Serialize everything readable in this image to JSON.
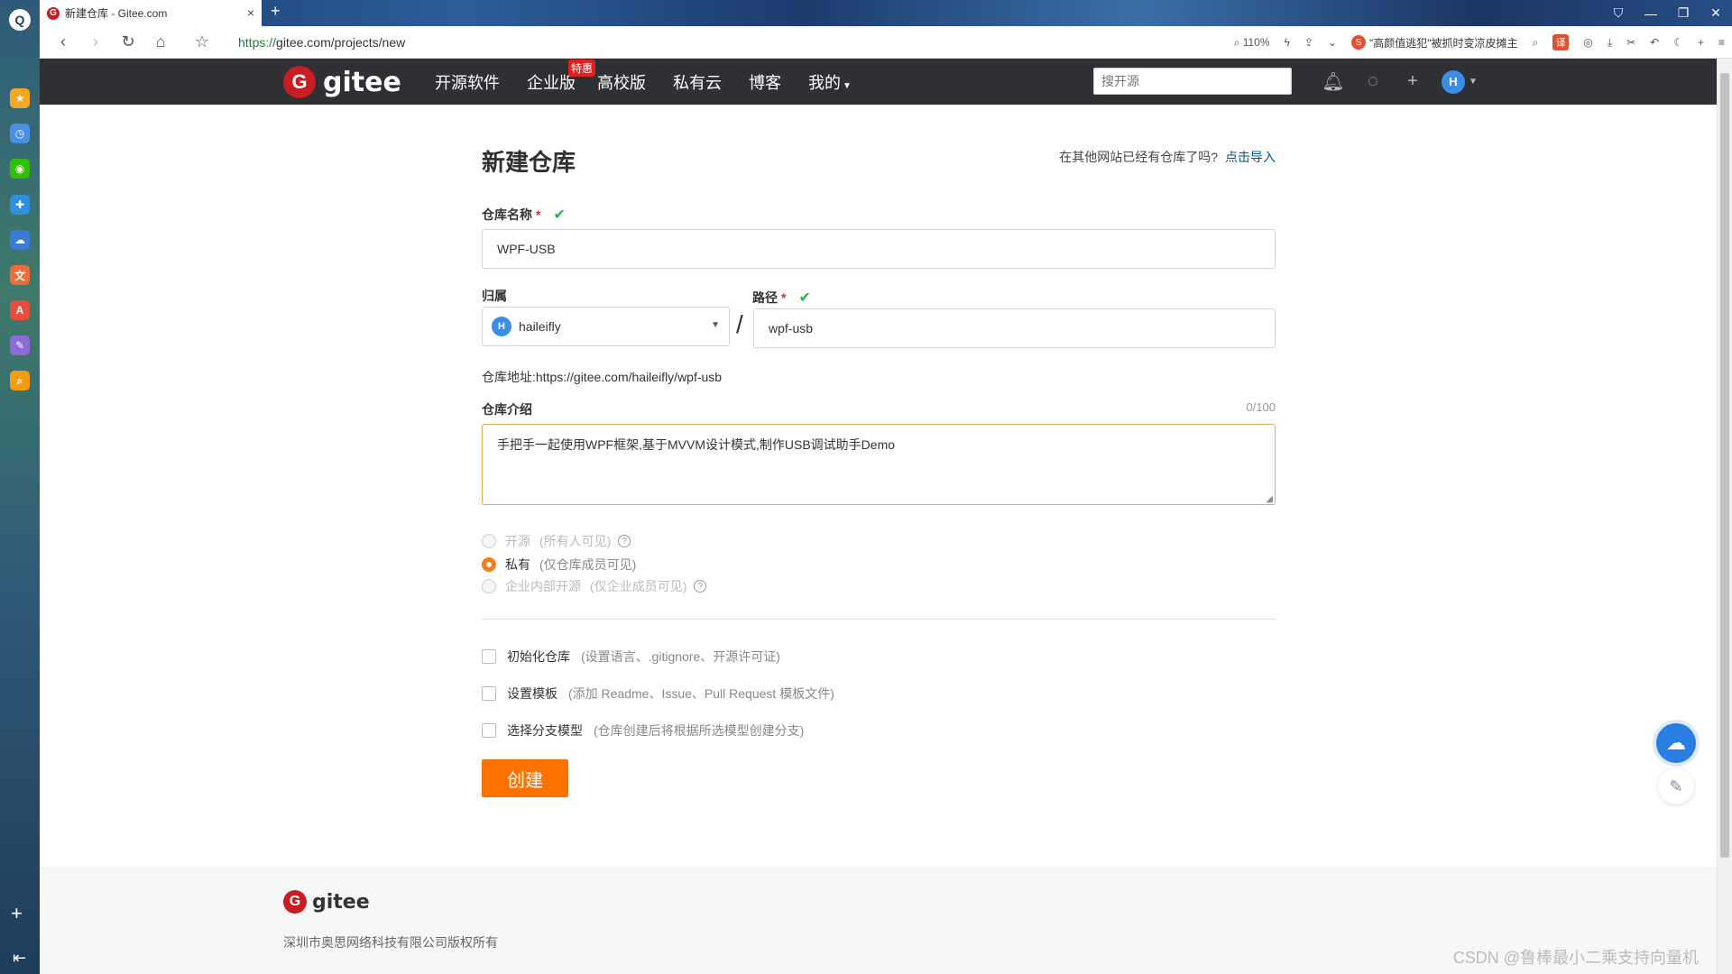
{
  "browser": {
    "tab_title": "新建仓库 - Gitee.com",
    "url_scheme": "https://",
    "url_rest": "gitee.com/projects/new",
    "zoom": "110%",
    "news_ticker": "\"高颜值逃犯\"被抓时变凉皮摊主",
    "translate_badge": "译"
  },
  "sidebar": {
    "icons": [
      {
        "name": "favorites-icon",
        "color": "#f5a623",
        "glyph": "★"
      },
      {
        "name": "history-icon",
        "color": "#4a90e2",
        "glyph": "◷"
      },
      {
        "name": "wechat-icon",
        "color": "#2dc100",
        "glyph": "◉"
      },
      {
        "name": "app-icon",
        "color": "#2f8fdd",
        "glyph": "✚"
      },
      {
        "name": "cloud-icon",
        "color": "#3a7bd5",
        "glyph": "☁"
      },
      {
        "name": "translate-icon",
        "color": "#ef6b3a",
        "glyph": "文"
      },
      {
        "name": "pdf-icon",
        "color": "#e84c3d",
        "glyph": "A"
      },
      {
        "name": "notes-icon",
        "color": "#8e6ad8",
        "glyph": "✎"
      },
      {
        "name": "search-app-icon",
        "color": "#f39c12",
        "glyph": "⌕"
      }
    ]
  },
  "header": {
    "logo_text": "gitee",
    "nav": [
      {
        "label": "开源软件"
      },
      {
        "label": "企业版",
        "badge": "特惠"
      },
      {
        "label": "高校版"
      },
      {
        "label": "私有云"
      },
      {
        "label": "博客"
      },
      {
        "label": "我的"
      }
    ],
    "search_placeholder": "搜开源",
    "avatar_letter": "H"
  },
  "form": {
    "title": "新建仓库",
    "import_tip": "在其他网站已经有仓库了吗?",
    "import_link": "点击导入",
    "repo_name_label": "仓库名称",
    "repo_name_value": "WPF-USB",
    "owner_label": "归属",
    "owner_avatar": "H",
    "owner_value": "haileifly",
    "path_label": "路径",
    "path_value": "wpf-usb",
    "repo_url_text": "仓库地址:https://gitee.com/haileifly/wpf-usb",
    "desc_label": "仓库介绍",
    "desc_count": "0/100",
    "desc_value": "手把手一起使用WPF框架,基于MVVM设计模式,制作USB调试助手Demo",
    "visibility": [
      {
        "label": "开源",
        "note": "(所有人可见)",
        "checked": false,
        "disabled": true,
        "help": true
      },
      {
        "label": "私有",
        "note": "(仅仓库成员可见)",
        "checked": true,
        "disabled": false,
        "help": false
      },
      {
        "label": "企业内部开源",
        "note": "(仅企业成员可见)",
        "checked": false,
        "disabled": true,
        "help": true
      }
    ],
    "options": [
      {
        "label": "初始化仓库",
        "note": "(设置语言、.gitignore、开源许可证)"
      },
      {
        "label": "设置模板",
        "note": "(添加 Readme、Issue、Pull Request 模板文件)"
      },
      {
        "label": "选择分支模型",
        "note": "(仓库创建后将根据所选模型创建分支)"
      }
    ],
    "create_button": "创建"
  },
  "footer": {
    "logo_text": "gitee",
    "copyright": "深圳市奥思网络科技有限公司版权所有",
    "watermark": "CSDN @鲁棒最小二乘支持向量机"
  },
  "colors": {
    "header_bg": "#2e3033",
    "accent_orange": "#fe7300",
    "brand_red": "#c71d23",
    "ok_green": "#21ba45",
    "link_blue": "#005980"
  }
}
